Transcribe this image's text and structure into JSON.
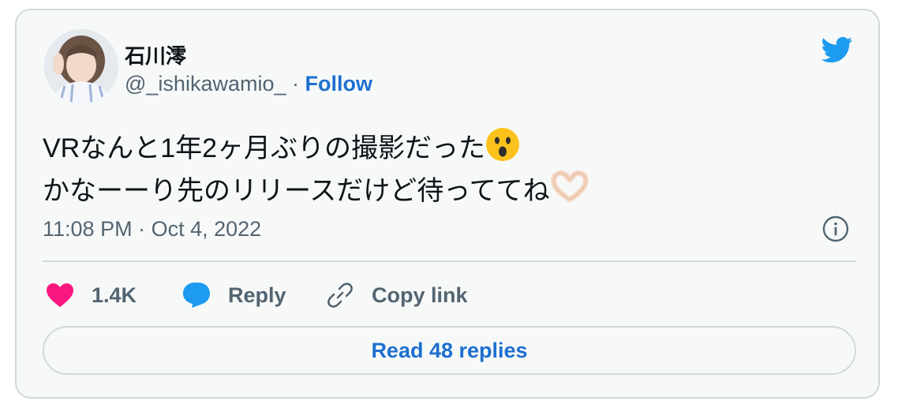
{
  "author": {
    "display_name": "石川澪",
    "handle": "@_ishikawamio_",
    "separator": "·",
    "follow_label": "Follow"
  },
  "tweet": {
    "line1": "VRなんと1年2ヶ月ぶりの撮影だった",
    "line2": "かなーーり先のリリースだけど待っててね"
  },
  "meta": {
    "time": "11:08 PM",
    "separator": "·",
    "date": "Oct 4, 2022"
  },
  "actions": {
    "like_count": "1.4K",
    "reply_label": "Reply",
    "copy_link_label": "Copy link"
  },
  "read_replies_label": "Read 48 replies",
  "colors": {
    "accent": "#1d6fd0",
    "twitter_blue": "#1d9bf0",
    "like_pink": "#f91880",
    "text_secondary": "#536471",
    "border": "#cfd9de"
  },
  "icons": [
    "twitter-bird-icon",
    "info-icon",
    "heart-icon",
    "reply-bubble-icon",
    "link-icon",
    "surprised-face-emoji",
    "heart-hands-emoji"
  ]
}
